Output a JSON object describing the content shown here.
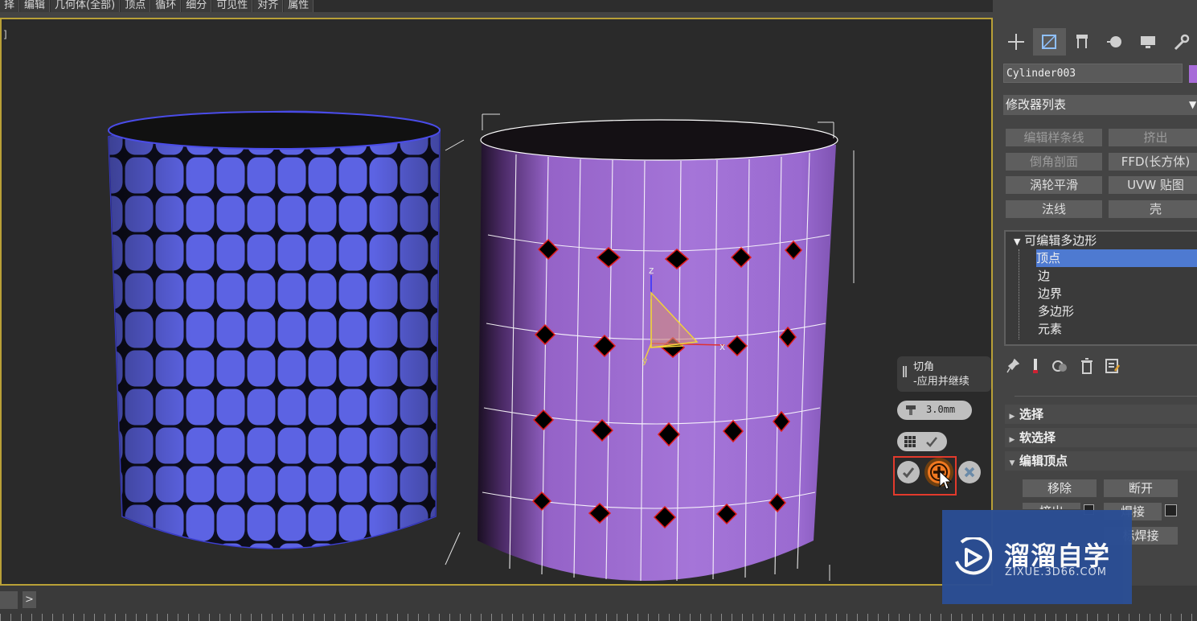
{
  "menubar": {
    "items": [
      "择",
      "编辑",
      "几何体(全部)",
      "顶点",
      "循环",
      "细分",
      "可见性",
      "对齐",
      "属性"
    ]
  },
  "viewport": {
    "label": "]"
  },
  "caddy": {
    "title": "切角",
    "subtitle": "-应用并继续",
    "amount": "3.0mm"
  },
  "panel": {
    "object_name": "Cylinder003",
    "object_color": "#a76bd8",
    "modifier_list": "修改器列表",
    "modifier_list_arrow": "▼",
    "modifier_buttons": [
      "编辑样条线",
      "挤出",
      "倒角剖面",
      "FFD(长方体)",
      "涡轮平滑",
      "UVW 贴图",
      "法线",
      "壳"
    ],
    "stack": {
      "root": "可编辑多边形",
      "items": [
        "顶点",
        "边",
        "边界",
        "多边形",
        "元素"
      ],
      "selected": "顶点"
    },
    "rollouts": {
      "selection": "选择",
      "soft_selection": "软选择",
      "edit_vertices": "编辑顶点"
    },
    "edit_vertex_buttons": [
      "移除",
      "断开",
      "挤出",
      "焊接",
      "标焊接"
    ]
  },
  "timebar": {
    "next": ">"
  },
  "watermark": {
    "title": "溜溜自学",
    "url": "ZIXUE.3D66.COM"
  },
  "colors": {
    "selection_border": "#b9a037",
    "highlight_box": "#e23a2c",
    "stack_selected": "#4e7ad1",
    "watermark_bg": "#2b4e94"
  }
}
